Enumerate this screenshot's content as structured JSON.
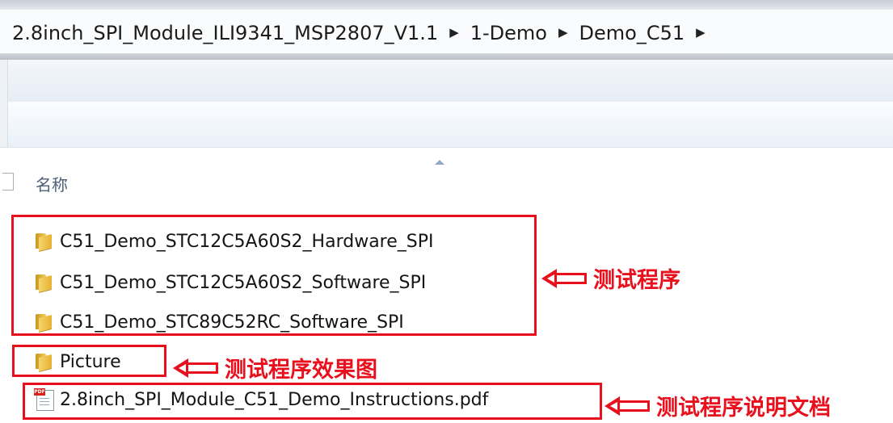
{
  "address_bar": {
    "crumbs": [
      "2.8inch_SPI_Module_ILI9341_MSP2807_V1.1",
      "1-Demo",
      "Demo_C51"
    ],
    "separator": "▶"
  },
  "column_header": {
    "name_label": "名称"
  },
  "files": [
    {
      "name": "C51_Demo_STC12C5A60S2_Hardware_SPI",
      "icon": "folder-icon"
    },
    {
      "name": "C51_Demo_STC12C5A60S2_Software_SPI",
      "icon": "folder-icon"
    },
    {
      "name": "C51_Demo_STC89C52RC_Software_SPI",
      "icon": "folder-icon"
    },
    {
      "name": "Picture",
      "icon": "folder-icon"
    },
    {
      "name": "2.8inch_SPI_Module_C51_Demo_Instructions.pdf",
      "icon": "pdf-file-icon"
    }
  ],
  "pdf_icon_tag": "PDF",
  "annotations": [
    {
      "text": "测试程序"
    },
    {
      "text": "测试程序效果图"
    },
    {
      "text": "测试程序说明文档"
    }
  ],
  "colors": {
    "annotation_red": "#e8101d",
    "header_text": "#4c607a"
  }
}
